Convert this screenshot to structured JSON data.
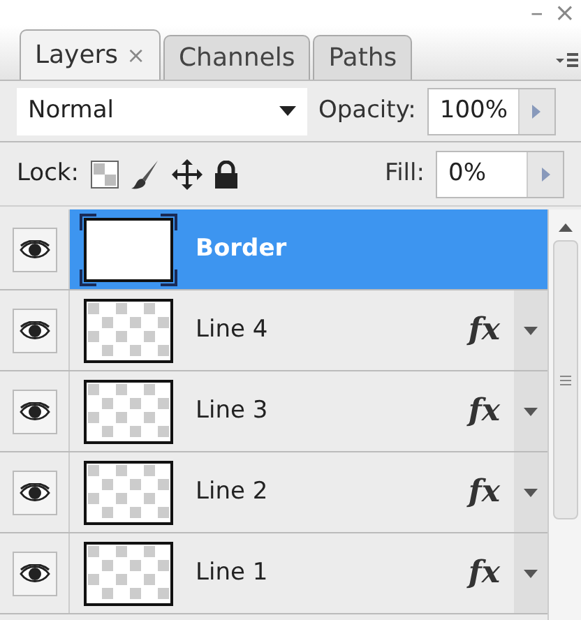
{
  "window": {
    "minimize": "–",
    "close": "×"
  },
  "tabs": [
    {
      "label": "Layers",
      "close": "×",
      "selected": true
    },
    {
      "label": "Channels",
      "selected": false
    },
    {
      "label": "Paths",
      "selected": false
    }
  ],
  "blend_mode": {
    "value": "Normal"
  },
  "opacity": {
    "label": "Opacity:",
    "value": "100%"
  },
  "lock": {
    "label": "Lock:"
  },
  "fill": {
    "label": "Fill:",
    "value": "0%"
  },
  "layers": [
    {
      "name": "Border",
      "kind": "solid",
      "visible": true,
      "selected": true
    },
    {
      "name": "Line 4",
      "kind": "transparent",
      "visible": true,
      "selected": false,
      "effects": "fx"
    },
    {
      "name": "Line 3",
      "kind": "transparent",
      "visible": true,
      "selected": false,
      "effects": "fx"
    },
    {
      "name": "Line 2",
      "kind": "transparent",
      "visible": true,
      "selected": false,
      "effects": "fx"
    },
    {
      "name": "Line 1",
      "kind": "transparent",
      "visible": true,
      "selected": false,
      "effects": "fx"
    }
  ]
}
